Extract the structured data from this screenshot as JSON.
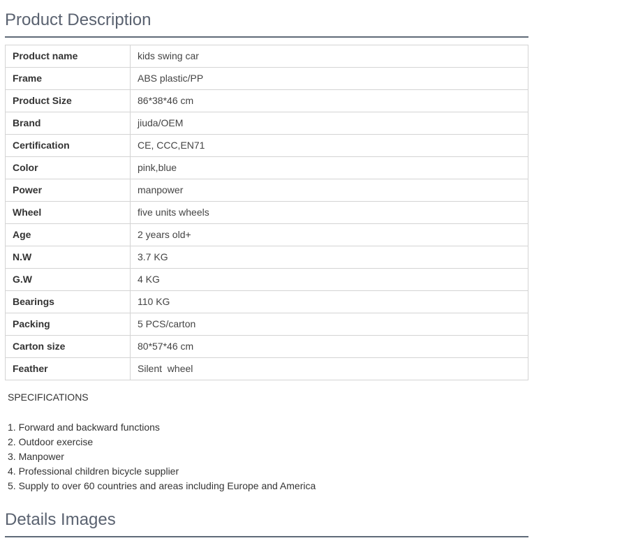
{
  "product_section": {
    "title": "Product Description"
  },
  "spec_table": {
    "rows": [
      {
        "key": "Product name",
        "value": "kids swing car"
      },
      {
        "key": "Frame",
        "value": "ABS plastic/PP"
      },
      {
        "key": "Product Size",
        "value": "86*38*46 cm"
      },
      {
        "key": "Brand",
        "value": "jiuda/OEM"
      },
      {
        "key": "Certification",
        "value": "CE, CCC,EN71"
      },
      {
        "key": "Color",
        "value": "pink,blue"
      },
      {
        "key": "Power",
        "value": "manpower"
      },
      {
        "key": "Wheel",
        "value": "five units wheels"
      },
      {
        "key": "Age",
        "value": "2 years old+"
      },
      {
        "key": "N.W",
        "value": "3.7 KG"
      },
      {
        "key": "G.W",
        "value": "4 KG"
      },
      {
        "key": "Bearings",
        "value": "110 KG"
      },
      {
        "key": "Packing",
        "value": "5 PCS/carton"
      },
      {
        "key": "Carton size",
        "value": "80*57*46 cm"
      },
      {
        "key": "Feather",
        "value": "Silent  wheel"
      }
    ]
  },
  "specifications": {
    "heading": "SPECIFICATIONS",
    "items": [
      "1. Forward and backward functions",
      "2. Outdoor exercise",
      "3. Manpower",
      "4. Professional children bicycle supplier",
      "5. Supply to over 60 countries and areas including Europe and America"
    ]
  },
  "details_section": {
    "title": "Details Images"
  },
  "colors": {
    "heading_text": "#5a6270",
    "rule": "#5f6a78",
    "table_border": "#d4d4d4"
  }
}
